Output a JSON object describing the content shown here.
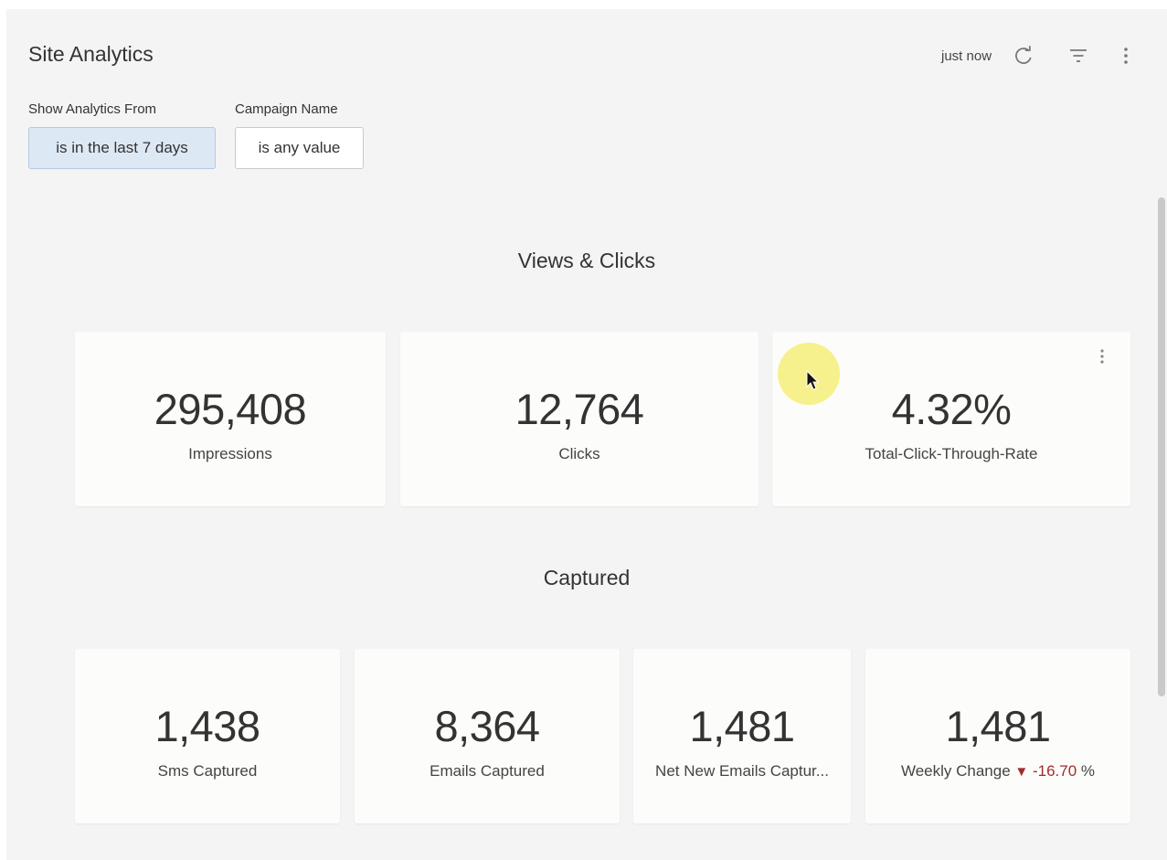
{
  "header": {
    "title": "Site Analytics",
    "updated": "just now",
    "refresh_icon": "refresh-icon",
    "filter_icon": "filter-icon",
    "menu_icon": "more-vert-icon"
  },
  "filters": [
    {
      "label": "Show Analytics From",
      "value": "is in the last 7 days"
    },
    {
      "label": "Campaign Name",
      "value": "is any value"
    }
  ],
  "sections": {
    "views": {
      "title": "Views & Clicks",
      "cards": [
        {
          "value": "295,408",
          "label": "Impressions"
        },
        {
          "value": "12,764",
          "label": "Clicks"
        },
        {
          "value": "4.32%",
          "label": "Total-Click-Through-Rate"
        }
      ]
    },
    "captured": {
      "title": "Captured",
      "cards": [
        {
          "value": "1,438",
          "label": "Sms Captured"
        },
        {
          "value": "8,364",
          "label": "Emails Captured"
        },
        {
          "value": "1,481",
          "label": "Net New Emails Captur..."
        },
        {
          "value": "1,481",
          "label": "Weekly Change",
          "change_icon": "triangle-down-icon",
          "change": "-16.70",
          "unit": "%"
        }
      ]
    }
  },
  "colors": {
    "active_filter_bg": "#dde8f5",
    "negative": "#a12c2c",
    "cursor_highlight": "#f5ee78"
  }
}
